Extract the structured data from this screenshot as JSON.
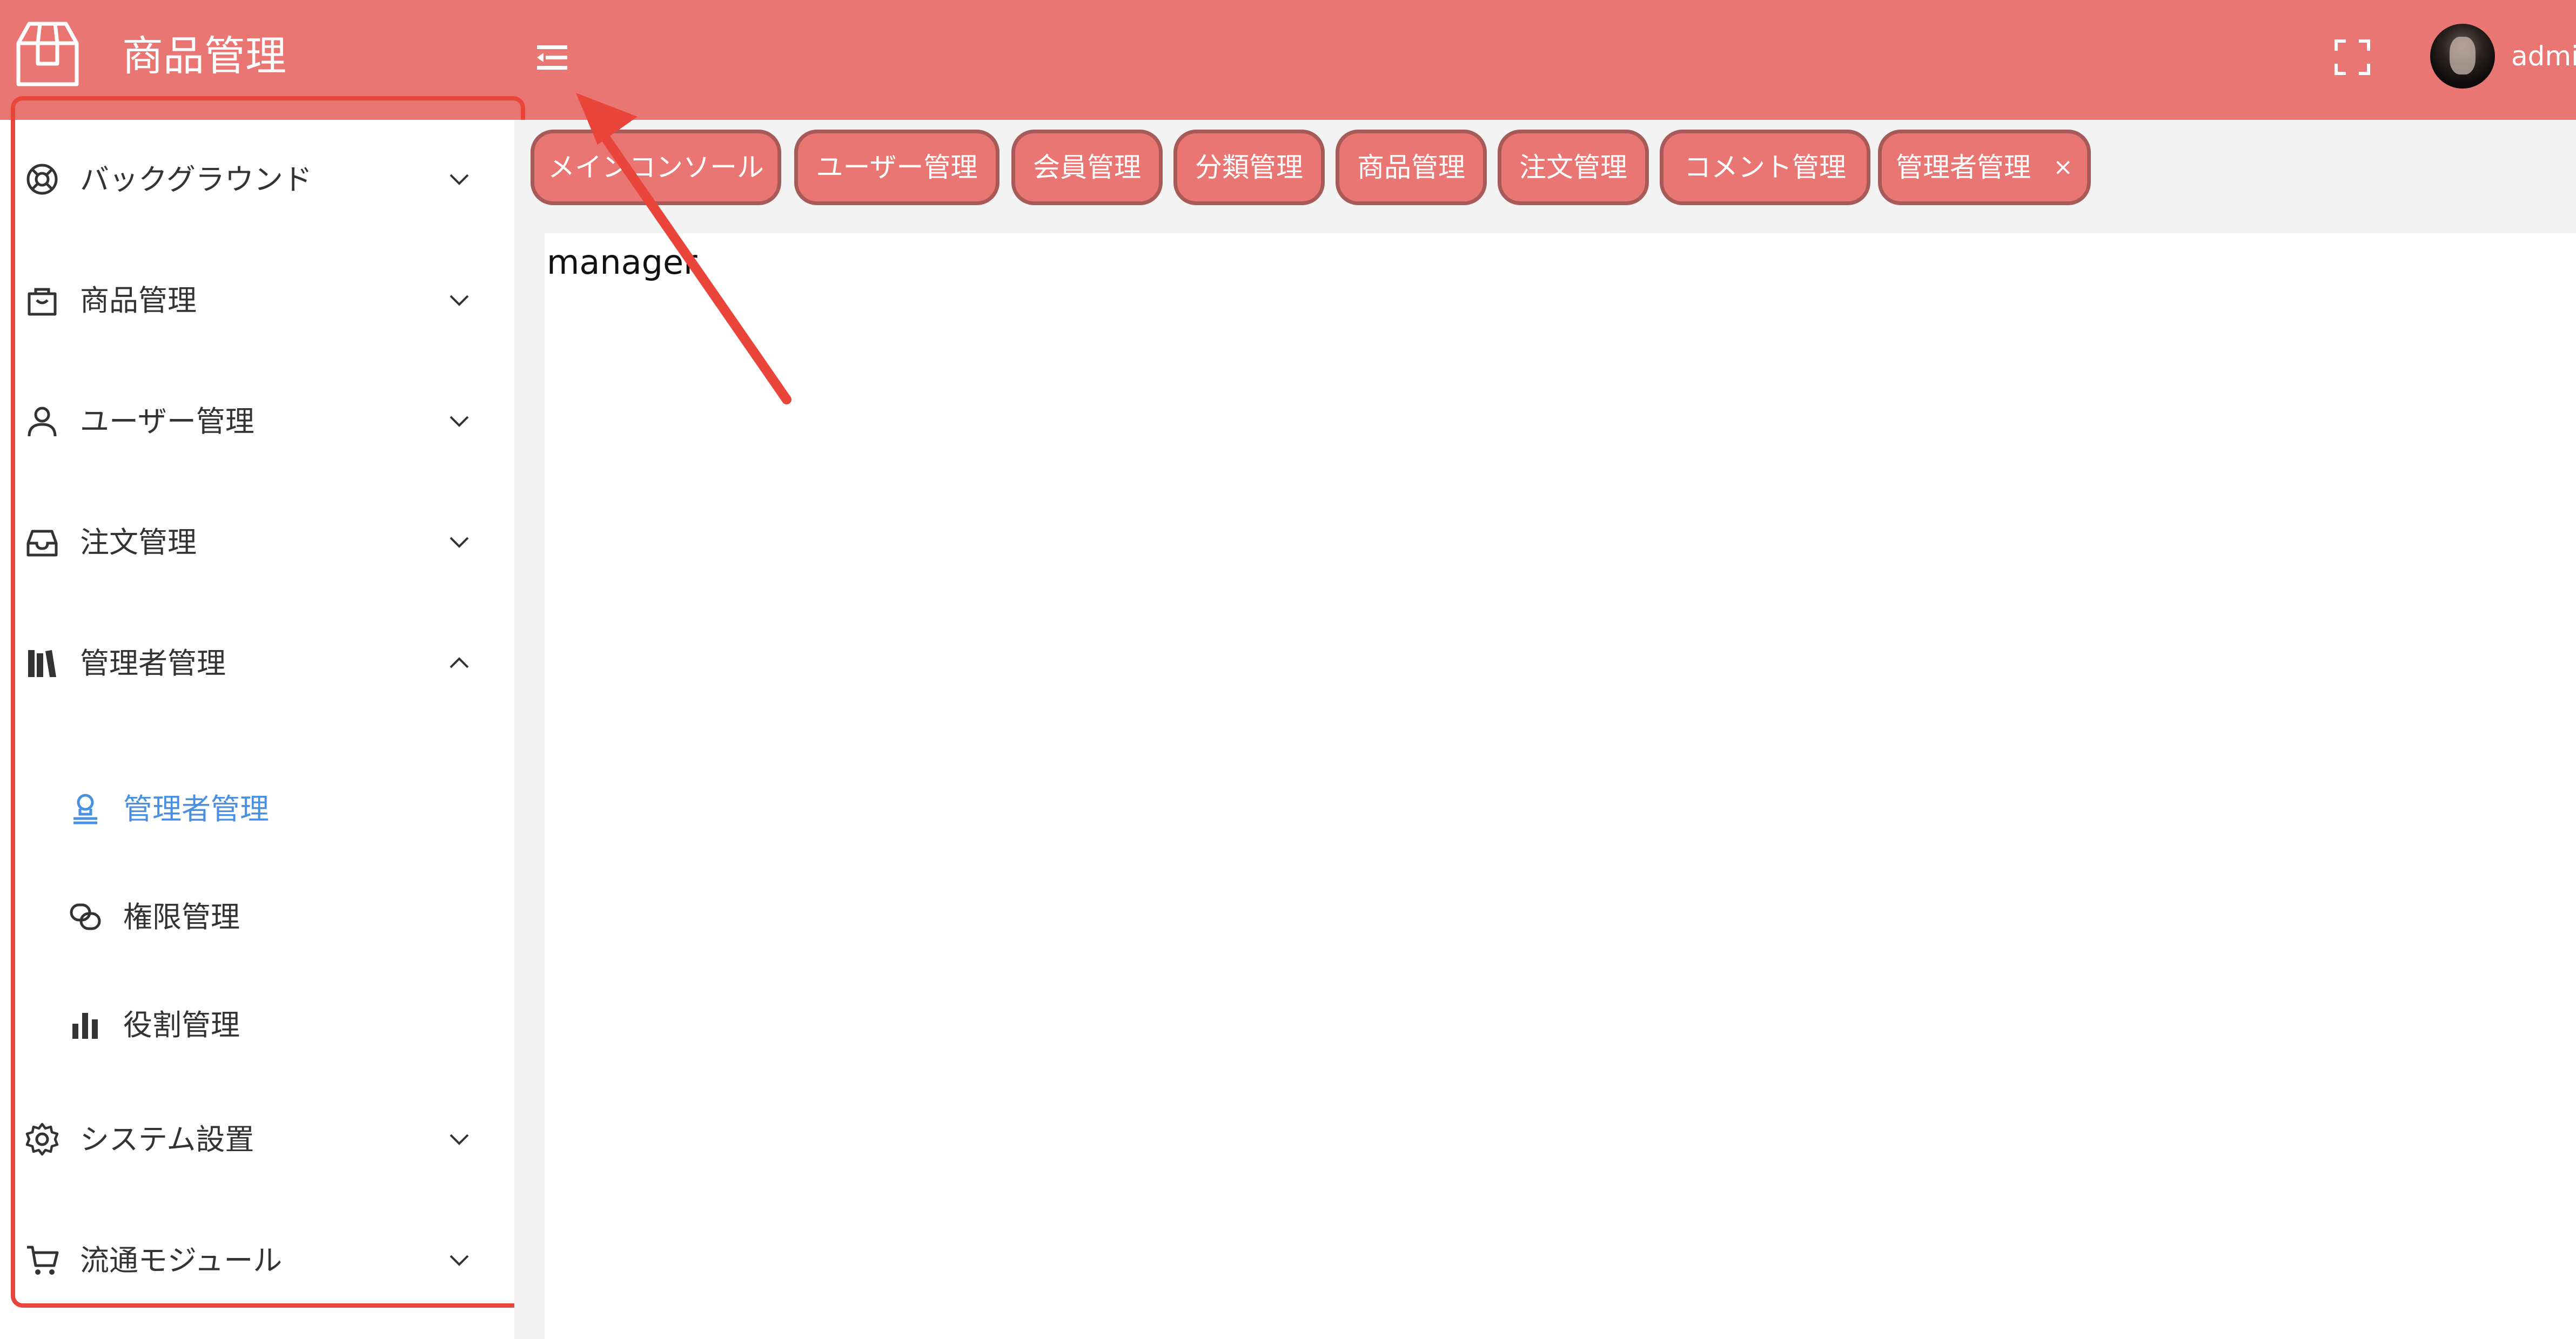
{
  "header": {
    "title": "商品管理",
    "logo_icon": "package-box-icon",
    "collapse_icon": "menu-fold-icon",
    "fullscreen_icon": "fullscreen-icon",
    "username": "admin",
    "bg_color": "#e97672"
  },
  "sidebar": {
    "items": [
      {
        "label": "バックグラウンド",
        "icon": "lifebuoy-icon",
        "expanded": false
      },
      {
        "label": "商品管理",
        "icon": "shopping-bag-icon",
        "expanded": false
      },
      {
        "label": "ユーザー管理",
        "icon": "user-icon",
        "expanded": false
      },
      {
        "label": "注文管理",
        "icon": "inbox-icon",
        "expanded": false
      },
      {
        "label": "管理者管理",
        "icon": "library-icon",
        "expanded": true,
        "children": [
          {
            "label": "管理者管理",
            "icon": "user-stamp-icon",
            "active": true
          },
          {
            "label": "権限管理",
            "icon": "link-icon",
            "active": false
          },
          {
            "label": "役割管理",
            "icon": "bar-chart-icon",
            "active": false
          }
        ]
      },
      {
        "label": "システム設置",
        "icon": "gear-icon",
        "expanded": false
      },
      {
        "label": "流通モジュール",
        "icon": "cart-icon",
        "expanded": false
      }
    ],
    "active_color": "#4a90e2"
  },
  "tabs": [
    {
      "label": "メインコンソール"
    },
    {
      "label": "ユーザー管理"
    },
    {
      "label": "会員管理"
    },
    {
      "label": "分類管理"
    },
    {
      "label": "商品管理"
    },
    {
      "label": "注文管理"
    },
    {
      "label": "コメント管理"
    },
    {
      "label": "管理者管理",
      "active": true,
      "closable": true,
      "close_label": "×"
    }
  ],
  "main": {
    "page_text": "manager"
  },
  "annotation": {
    "color": "#e9453a"
  }
}
